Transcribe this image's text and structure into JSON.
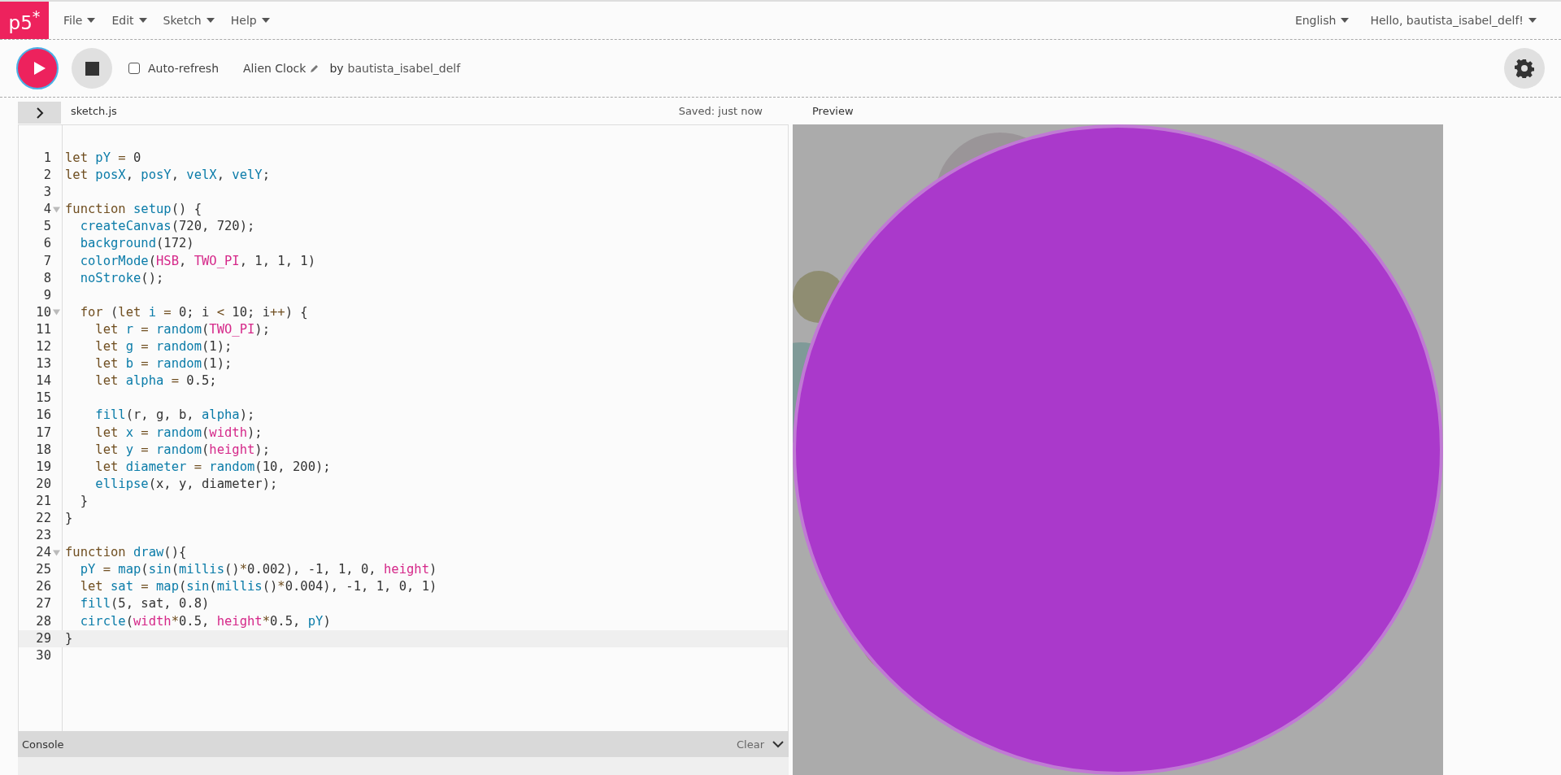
{
  "logo": "p5$^{*}$",
  "menu": [
    {
      "label": "File"
    },
    {
      "label": "Edit"
    },
    {
      "label": "Sketch"
    },
    {
      "label": "Help"
    }
  ],
  "language": "English",
  "user": "Hello, bautista_isabel_delf!",
  "toolbar": {
    "auto_refresh": {
      "label": "Auto-refresh",
      "checked": false
    },
    "sketch_name": "Alien Clock",
    "by": "by",
    "author": "bautista_isabel_delf"
  },
  "editor": {
    "file": "sketch.js",
    "saved": "Saved: just now",
    "lines": [
      {
        "n": "1",
        "fold": false,
        "active": false,
        "tokens": [
          {
            "kind": "keyword",
            "text": "let "
          },
          {
            "kind": "name",
            "text": "pY "
          },
          {
            "kind": "operator",
            "text": "= "
          },
          {
            "kind": "plain",
            "text": "0"
          }
        ]
      },
      {
        "n": "2",
        "fold": false,
        "active": false,
        "tokens": [
          {
            "kind": "keyword",
            "text": "let "
          },
          {
            "kind": "name",
            "text": "posX"
          },
          {
            "kind": "plain",
            "text": ", "
          },
          {
            "kind": "name",
            "text": "posY"
          },
          {
            "kind": "plain",
            "text": ", "
          },
          {
            "kind": "name",
            "text": "velX"
          },
          {
            "kind": "plain",
            "text": ", "
          },
          {
            "kind": "name",
            "text": "velY"
          },
          {
            "kind": "plain",
            "text": ";"
          }
        ]
      },
      {
        "n": "3",
        "fold": false,
        "active": false
      },
      {
        "n": "4",
        "fold": true,
        "active": false,
        "tokens": [
          {
            "kind": "keyword",
            "text": "function "
          },
          {
            "kind": "name",
            "text": "setup"
          },
          {
            "kind": "plain",
            "text": "() {"
          }
        ]
      },
      {
        "n": "5",
        "fold": false,
        "active": false,
        "tokens": [
          {
            "kind": "name",
            "text": "  createCanvas"
          },
          {
            "kind": "plain",
            "text": "(720, 720);"
          }
        ]
      },
      {
        "n": "6",
        "fold": false,
        "active": false,
        "tokens": [
          {
            "kind": "name",
            "text": "  background"
          },
          {
            "kind": "plain",
            "text": "(172)"
          }
        ]
      },
      {
        "n": "7",
        "fold": false,
        "active": false,
        "tokens": [
          {
            "kind": "name",
            "text": "  colorMode"
          },
          {
            "kind": "plain",
            "text": "("
          },
          {
            "kind": "constant",
            "text": "HSB"
          },
          {
            "kind": "plain",
            "text": ", "
          },
          {
            "kind": "constant",
            "text": "TWO_PI"
          },
          {
            "kind": "plain",
            "text": ", 1, 1, 1)"
          }
        ]
      },
      {
        "n": "8",
        "fold": false,
        "active": false,
        "tokens": [
          {
            "kind": "name",
            "text": "  noStroke"
          },
          {
            "kind": "plain",
            "text": "();"
          }
        ]
      },
      {
        "n": "9",
        "fold": false,
        "active": false
      },
      {
        "n": "10",
        "fold": true,
        "active": false,
        "tokens": [
          {
            "kind": "keyword",
            "text": "  for "
          },
          {
            "kind": "plain",
            "text": "("
          },
          {
            "kind": "keyword",
            "text": "let "
          },
          {
            "kind": "name",
            "text": "i "
          },
          {
            "kind": "operator",
            "text": "= "
          },
          {
            "kind": "plain",
            "text": "0; i "
          },
          {
            "kind": "operator",
            "text": "< "
          },
          {
            "kind": "plain",
            "text": "10; i"
          },
          {
            "kind": "operator",
            "text": "++"
          },
          {
            "kind": "plain",
            "text": ") {"
          }
        ]
      },
      {
        "n": "11",
        "fold": false,
        "active": false,
        "tokens": [
          {
            "kind": "keyword",
            "text": "    let "
          },
          {
            "kind": "name",
            "text": "r "
          },
          {
            "kind": "operator",
            "text": "= "
          },
          {
            "kind": "name",
            "text": "random"
          },
          {
            "kind": "plain",
            "text": "("
          },
          {
            "kind": "constant",
            "text": "TWO_PI"
          },
          {
            "kind": "plain",
            "text": ");"
          }
        ]
      },
      {
        "n": "12",
        "fold": false,
        "active": false,
        "tokens": [
          {
            "kind": "keyword",
            "text": "    let "
          },
          {
            "kind": "name",
            "text": "g "
          },
          {
            "kind": "operator",
            "text": "= "
          },
          {
            "kind": "name",
            "text": "random"
          },
          {
            "kind": "plain",
            "text": "(1);"
          }
        ]
      },
      {
        "n": "13",
        "fold": false,
        "active": false,
        "tokens": [
          {
            "kind": "keyword",
            "text": "    let "
          },
          {
            "kind": "name",
            "text": "b "
          },
          {
            "kind": "operator",
            "text": "= "
          },
          {
            "kind": "name",
            "text": "random"
          },
          {
            "kind": "plain",
            "text": "(1);"
          }
        ]
      },
      {
        "n": "14",
        "fold": false,
        "active": false,
        "tokens": [
          {
            "kind": "keyword",
            "text": "    let "
          },
          {
            "kind": "name",
            "text": "alpha "
          },
          {
            "kind": "operator",
            "text": "= "
          },
          {
            "kind": "plain",
            "text": "0.5;"
          }
        ]
      },
      {
        "n": "15",
        "fold": false,
        "active": false
      },
      {
        "n": "16",
        "fold": false,
        "active": false,
        "tokens": [
          {
            "kind": "name",
            "text": "    fill"
          },
          {
            "kind": "plain",
            "text": "(r, g, b, "
          },
          {
            "kind": "name",
            "text": "alpha"
          },
          {
            "kind": "plain",
            "text": ");"
          }
        ]
      },
      {
        "n": "17",
        "fold": false,
        "active": false,
        "tokens": [
          {
            "kind": "keyword",
            "text": "    let "
          },
          {
            "kind": "name",
            "text": "x "
          },
          {
            "kind": "operator",
            "text": "= "
          },
          {
            "kind": "name",
            "text": "random"
          },
          {
            "kind": "plain",
            "text": "("
          },
          {
            "kind": "constant",
            "text": "width"
          },
          {
            "kind": "plain",
            "text": ");"
          }
        ]
      },
      {
        "n": "18",
        "fold": false,
        "active": false,
        "tokens": [
          {
            "kind": "keyword",
            "text": "    let "
          },
          {
            "kind": "name",
            "text": "y "
          },
          {
            "kind": "operator",
            "text": "= "
          },
          {
            "kind": "name",
            "text": "random"
          },
          {
            "kind": "plain",
            "text": "("
          },
          {
            "kind": "constant",
            "text": "height"
          },
          {
            "kind": "plain",
            "text": ");"
          }
        ]
      },
      {
        "n": "19",
        "fold": false,
        "active": false,
        "tokens": [
          {
            "kind": "keyword",
            "text": "    let "
          },
          {
            "kind": "name",
            "text": "diameter "
          },
          {
            "kind": "operator",
            "text": "= "
          },
          {
            "kind": "name",
            "text": "random"
          },
          {
            "kind": "plain",
            "text": "(10, 200);"
          }
        ]
      },
      {
        "n": "20",
        "fold": false,
        "active": false,
        "tokens": [
          {
            "kind": "name",
            "text": "    ellipse"
          },
          {
            "kind": "plain",
            "text": "(x, y, diameter);"
          }
        ]
      },
      {
        "n": "21",
        "fold": false,
        "active": false,
        "tokens": [
          {
            "kind": "plain",
            "text": "  }"
          }
        ]
      },
      {
        "n": "22",
        "fold": false,
        "active": false,
        "tokens": [
          {
            "kind": "plain",
            "text": "}"
          }
        ]
      },
      {
        "n": "23",
        "fold": false,
        "active": false
      },
      {
        "n": "24",
        "fold": true,
        "active": false,
        "tokens": [
          {
            "kind": "keyword",
            "text": "function "
          },
          {
            "kind": "name",
            "text": "draw"
          },
          {
            "kind": "plain",
            "text": "(){"
          }
        ]
      },
      {
        "n": "25",
        "fold": false,
        "active": false,
        "tokens": [
          {
            "kind": "name",
            "text": "  pY "
          },
          {
            "kind": "operator",
            "text": "= "
          },
          {
            "kind": "name",
            "text": "map"
          },
          {
            "kind": "plain",
            "text": "("
          },
          {
            "kind": "name",
            "text": "sin"
          },
          {
            "kind": "plain",
            "text": "("
          },
          {
            "kind": "name",
            "text": "millis"
          },
          {
            "kind": "plain",
            "text": "()"
          },
          {
            "kind": "operator",
            "text": "*"
          },
          {
            "kind": "plain",
            "text": "0.002), -1, 1, 0, "
          },
          {
            "kind": "constant",
            "text": "height"
          },
          {
            "kind": "plain",
            "text": ")"
          }
        ]
      },
      {
        "n": "26",
        "fold": false,
        "active": false,
        "tokens": [
          {
            "kind": "keyword",
            "text": "  let "
          },
          {
            "kind": "name",
            "text": "sat "
          },
          {
            "kind": "operator",
            "text": "= "
          },
          {
            "kind": "name",
            "text": "map"
          },
          {
            "kind": "plain",
            "text": "("
          },
          {
            "kind": "name",
            "text": "sin"
          },
          {
            "kind": "plain",
            "text": "("
          },
          {
            "kind": "name",
            "text": "millis"
          },
          {
            "kind": "plain",
            "text": "()"
          },
          {
            "kind": "operator",
            "text": "*"
          },
          {
            "kind": "plain",
            "text": "0.004), -1, 1, 0, 1)"
          }
        ]
      },
      {
        "n": "27",
        "fold": false,
        "active": false,
        "tokens": [
          {
            "kind": "name",
            "text": "  fill"
          },
          {
            "kind": "plain",
            "text": "(5, sat, 0.8)"
          }
        ]
      },
      {
        "n": "28",
        "fold": false,
        "active": false,
        "tokens": [
          {
            "kind": "name",
            "text": "  circle"
          },
          {
            "kind": "plain",
            "text": "("
          },
          {
            "kind": "constant",
            "text": "width"
          },
          {
            "kind": "operator",
            "text": "*"
          },
          {
            "kind": "plain",
            "text": "0.5, "
          },
          {
            "kind": "constant",
            "text": "height"
          },
          {
            "kind": "operator",
            "text": "*"
          },
          {
            "kind": "plain",
            "text": "0.5, "
          },
          {
            "kind": "name",
            "text": "pY"
          },
          {
            "kind": "plain",
            "text": ")"
          }
        ]
      },
      {
        "n": "29",
        "fold": false,
        "active": true,
        "tokens": [
          {
            "kind": "plain",
            "text": "}"
          }
        ]
      },
      {
        "n": "30",
        "fold": false,
        "active": false
      }
    ]
  },
  "console": {
    "title": "Console",
    "clear": "Clear"
  },
  "preview": {
    "title": "Preview"
  }
}
